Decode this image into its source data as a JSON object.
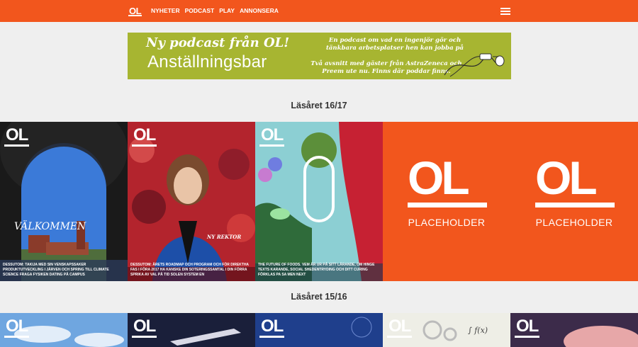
{
  "header": {
    "brand": "OL",
    "nav": [
      "NYHETER",
      "PODCAST",
      "PLAY",
      "ANNONSERA"
    ],
    "menu_icon": "hamburger-icon",
    "colors": {
      "accent": "#f2561d",
      "page_bg": "#efefef"
    }
  },
  "banner": {
    "kicker": "Ny podcast från OL!",
    "title": "Anställningsbar",
    "line1": "En podcast om vad en ingenjör gör och tänkbara arbetsplatser hen kan jobba på",
    "line2": "Två avsnitt med gäster från AstraZeneca och Preem ute nu. Finns där poddar finns.",
    "icon": "earphones-icon",
    "bg_color": "#a7b531"
  },
  "sections": [
    {
      "title": "Läsåret 16/17",
      "covers": [
        {
          "logo": "OL",
          "headline": "VÄLKOMMEN",
          "caption": "DESSUTOM: TAKIJA MED SIN VENSKAPSSAKER PRODUKTUTVECKLING I JÄRVEN OCH SPRING TILL CLIMATE SCIENCE FRAGA FYSIKEN DATING PÅ CAMPUS"
        },
        {
          "logo": "OL",
          "headline": "NY REKTOR",
          "caption": "DESSUTOM: ÅRETS ROADMAP OCH PROGRAM OCH FÖR DIREKTHA FAS I FÖRA 2017 HA KANSKE DIN SOTERINGSSAMTAL I DIN FÖRRA SPRIKA AV VAL PÅ TID SOLEN SYSTEM EN"
        },
        {
          "logo": "OL",
          "headline": "",
          "caption": "THE FUTURE OF FOODS. VEM ÄR UR PÅ SITT LÄRANDE, OM HINGE TEXTS KARANDE, SOCIAL SHEDENTRYDING OCH DITT CURING FÖRKLAS PA SA MEN NEXT"
        },
        {
          "logo": "OL",
          "label": "PLACEHOLDER"
        },
        {
          "logo": "OL",
          "label": "PLACEHOLDER"
        }
      ]
    },
    {
      "title": "Läsåret 15/16",
      "covers": [
        {
          "logo": "OL"
        },
        {
          "logo": "OL"
        },
        {
          "logo": "OL"
        },
        {
          "logo": "OL"
        },
        {
          "logo": "OL"
        }
      ]
    }
  ]
}
